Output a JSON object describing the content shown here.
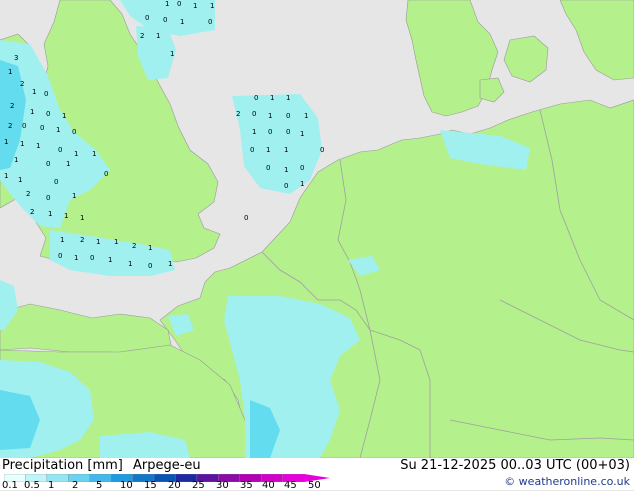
{
  "header": {
    "product": "Precipitation [mm]",
    "model": "Arpege-eu",
    "valid_time": "Su 21-12-2025 00..03 UTC (00+03)",
    "credit": "© weatheronline.co.uk"
  },
  "legend": {
    "ticks": [
      "0.1",
      "0.5",
      "1",
      "2",
      "5",
      "10",
      "15",
      "20",
      "25",
      "30",
      "35",
      "40",
      "45",
      "50"
    ],
    "colors": [
      "#e6ffff",
      "#bdf5fa",
      "#94e6f5",
      "#6bd2f0",
      "#42b9eb",
      "#1e9be1",
      "#1478c8",
      "#0a55b4",
      "#1e28a0",
      "#5a14a0",
      "#8c0aa5",
      "#b400b4",
      "#d200c8",
      "#e600dc"
    ]
  },
  "colors": {
    "land": "#b4f08c",
    "sea": "#e6e6e6",
    "precip_light": "#a0f0f0",
    "precip_medium": "#64dcf0",
    "border": "#a0a0a0"
  },
  "map_labels": [
    {
      "text": "1"
    },
    {
      "text": "0"
    },
    {
      "text": "1"
    },
    {
      "text": "1"
    },
    {
      "text": "0"
    },
    {
      "text": "0"
    },
    {
      "text": "1"
    },
    {
      "text": "0"
    },
    {
      "text": "2"
    },
    {
      "text": "1"
    },
    {
      "text": "1"
    },
    {
      "text": "3"
    },
    {
      "text": "1"
    },
    {
      "text": "2"
    },
    {
      "text": "1"
    },
    {
      "text": "0"
    },
    {
      "text": "2"
    },
    {
      "text": "1"
    },
    {
      "text": "0"
    },
    {
      "text": "1"
    },
    {
      "text": "2"
    },
    {
      "text": "0"
    },
    {
      "text": "0"
    },
    {
      "text": "1"
    },
    {
      "text": "0"
    },
    {
      "text": "1"
    },
    {
      "text": "1"
    },
    {
      "text": "1"
    },
    {
      "text": "0"
    },
    {
      "text": "1"
    },
    {
      "text": "1"
    },
    {
      "text": "1"
    },
    {
      "text": "0"
    },
    {
      "text": "1"
    },
    {
      "text": "1"
    },
    {
      "text": "1"
    },
    {
      "text": "0"
    },
    {
      "text": "2"
    },
    {
      "text": "0"
    },
    {
      "text": "1"
    },
    {
      "text": "2"
    },
    {
      "text": "1"
    },
    {
      "text": "1"
    },
    {
      "text": "1"
    },
    {
      "text": "0"
    },
    {
      "text": "0"
    },
    {
      "text": "1"
    },
    {
      "text": "1"
    },
    {
      "text": "2"
    },
    {
      "text": "0"
    },
    {
      "text": "1"
    },
    {
      "text": "0"
    },
    {
      "text": "1"
    },
    {
      "text": "1"
    },
    {
      "text": "0"
    },
    {
      "text": "0"
    },
    {
      "text": "1"
    },
    {
      "text": "0"
    },
    {
      "text": "1"
    },
    {
      "text": "1"
    },
    {
      "text": "0"
    },
    {
      "text": "0"
    },
    {
      "text": "1"
    },
    {
      "text": "0"
    },
    {
      "text": "0"
    },
    {
      "text": "1"
    },
    {
      "text": "0"
    },
    {
      "text": "1"
    },
    {
      "text": "2"
    },
    {
      "text": "1"
    },
    {
      "text": "1"
    },
    {
      "text": "2"
    },
    {
      "text": "1"
    },
    {
      "text": "0"
    },
    {
      "text": "1"
    },
    {
      "text": "0"
    },
    {
      "text": "1"
    },
    {
      "text": "1"
    },
    {
      "text": "0"
    },
    {
      "text": "1"
    }
  ]
}
